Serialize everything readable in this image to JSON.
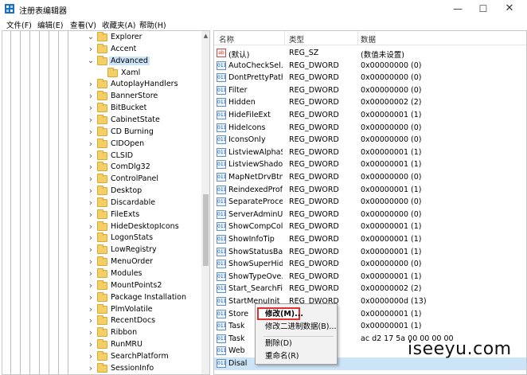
{
  "window": {
    "title": "注册表编辑器",
    "minimize": "—",
    "maximize": "☐",
    "close": "✕"
  },
  "menubar": [
    "文件(F)",
    "编辑(E)",
    "查看(V)",
    "收藏夹(A)",
    "帮助(H)"
  ],
  "tree": [
    {
      "label": "Explorer",
      "expanded": true
    },
    {
      "label": "Accent"
    },
    {
      "label": "Advanced",
      "expanded": true,
      "selected": true
    },
    {
      "label": "Xaml"
    },
    {
      "label": "AutoplayHandlers"
    },
    {
      "label": "BannerStore"
    },
    {
      "label": "BitBucket"
    },
    {
      "label": "CabinetState"
    },
    {
      "label": "CD Burning"
    },
    {
      "label": "CIDOpen"
    },
    {
      "label": "CLSID"
    },
    {
      "label": "ComDlg32"
    },
    {
      "label": "ControlPanel"
    },
    {
      "label": "Desktop"
    },
    {
      "label": "Discardable"
    },
    {
      "label": "FileExts"
    },
    {
      "label": "HideDesktopIcons"
    },
    {
      "label": "LogonStats"
    },
    {
      "label": "LowRegistry"
    },
    {
      "label": "MenuOrder"
    },
    {
      "label": "Modules"
    },
    {
      "label": "MountPoints2"
    },
    {
      "label": "Package Installation"
    },
    {
      "label": "PlmVolatile"
    },
    {
      "label": "RecentDocs"
    },
    {
      "label": "Ribbon"
    },
    {
      "label": "RunMRU"
    },
    {
      "label": "SearchPlatform"
    },
    {
      "label": "SessionInfo"
    }
  ],
  "columns": {
    "name": "名称",
    "type": "类型",
    "data": "数据"
  },
  "values": [
    {
      "icon": "ab",
      "name": "(默认)",
      "type": "REG_SZ",
      "data": "(数值未设置)"
    },
    {
      "icon": "011",
      "name": "AutoCheckSel...",
      "type": "REG_DWORD",
      "data": "0x00000000 (0)"
    },
    {
      "icon": "011",
      "name": "DontPrettyPath",
      "type": "REG_DWORD",
      "data": "0x00000000 (0)"
    },
    {
      "icon": "011",
      "name": "Filter",
      "type": "REG_DWORD",
      "data": "0x00000000 (0)"
    },
    {
      "icon": "011",
      "name": "Hidden",
      "type": "REG_DWORD",
      "data": "0x00000002 (2)"
    },
    {
      "icon": "011",
      "name": "HideFileExt",
      "type": "REG_DWORD",
      "data": "0x00000001 (1)"
    },
    {
      "icon": "011",
      "name": "HideIcons",
      "type": "REG_DWORD",
      "data": "0x00000000 (0)"
    },
    {
      "icon": "011",
      "name": "IconsOnly",
      "type": "REG_DWORD",
      "data": "0x00000000 (0)"
    },
    {
      "icon": "011",
      "name": "ListviewAlphaS...",
      "type": "REG_DWORD",
      "data": "0x00000001 (1)"
    },
    {
      "icon": "011",
      "name": "ListviewShadow",
      "type": "REG_DWORD",
      "data": "0x00000001 (1)"
    },
    {
      "icon": "011",
      "name": "MapNetDrvBtn",
      "type": "REG_DWORD",
      "data": "0x00000000 (0)"
    },
    {
      "icon": "011",
      "name": "ReindexedProf...",
      "type": "REG_DWORD",
      "data": "0x00000001 (1)"
    },
    {
      "icon": "011",
      "name": "SeparateProce...",
      "type": "REG_DWORD",
      "data": "0x00000000 (0)"
    },
    {
      "icon": "011",
      "name": "ServerAdminUI",
      "type": "REG_DWORD",
      "data": "0x00000000 (0)"
    },
    {
      "icon": "011",
      "name": "ShowCompCol...",
      "type": "REG_DWORD",
      "data": "0x00000001 (1)"
    },
    {
      "icon": "011",
      "name": "ShowInfoTip",
      "type": "REG_DWORD",
      "data": "0x00000001 (1)"
    },
    {
      "icon": "011",
      "name": "ShowStatusBar",
      "type": "REG_DWORD",
      "data": "0x00000001 (1)"
    },
    {
      "icon": "011",
      "name": "ShowSuperHid...",
      "type": "REG_DWORD",
      "data": "0x00000000 (0)"
    },
    {
      "icon": "011",
      "name": "ShowTypeOve...",
      "type": "REG_DWORD",
      "data": "0x00000001 (1)"
    },
    {
      "icon": "011",
      "name": "Start_SearchFil...",
      "type": "REG_DWORD",
      "data": "0x00000002 (2)"
    },
    {
      "icon": "011",
      "name": "StartMenuInit",
      "type": "REG_DWORD",
      "data": "0x0000000d (13)"
    },
    {
      "icon": "011",
      "name": "Store",
      "type": "",
      "data": "0x00000001 (1)"
    },
    {
      "icon": "011",
      "name": "Task",
      "type": "",
      "data": "0x00000001 (1)"
    },
    {
      "icon": "011",
      "name": "Task",
      "type": "",
      "data": "ac d2 17 5a 00 00 00 00"
    },
    {
      "icon": "011",
      "name": "Web",
      "type": "",
      "data": ""
    },
    {
      "icon": "011",
      "name": "Disal",
      "type": "",
      "data": "",
      "selected": true
    }
  ],
  "context_menu": {
    "modify": "修改(M)...",
    "modify_binary": "修改二进制数据(B)...",
    "delete": "删除(D)",
    "rename": "重命名(R)"
  },
  "watermark": "iseeyu.com",
  "colors": {
    "selection": "#cce4f7",
    "highlight_border": "#e03030",
    "folder": "#f4cf63"
  }
}
